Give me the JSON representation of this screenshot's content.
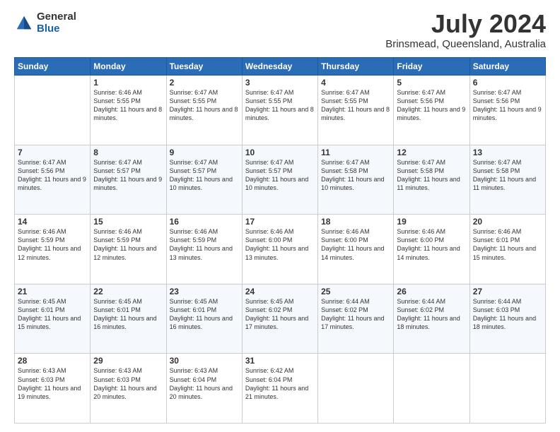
{
  "logo": {
    "general": "General",
    "blue": "Blue"
  },
  "title": {
    "month": "July 2024",
    "location": "Brinsmead, Queensland, Australia"
  },
  "headers": [
    "Sunday",
    "Monday",
    "Tuesday",
    "Wednesday",
    "Thursday",
    "Friday",
    "Saturday"
  ],
  "weeks": [
    [
      {
        "day": "",
        "sunrise": "",
        "sunset": "",
        "daylight": ""
      },
      {
        "day": "1",
        "sunrise": "Sunrise: 6:46 AM",
        "sunset": "Sunset: 5:55 PM",
        "daylight": "Daylight: 11 hours and 8 minutes."
      },
      {
        "day": "2",
        "sunrise": "Sunrise: 6:47 AM",
        "sunset": "Sunset: 5:55 PM",
        "daylight": "Daylight: 11 hours and 8 minutes."
      },
      {
        "day": "3",
        "sunrise": "Sunrise: 6:47 AM",
        "sunset": "Sunset: 5:55 PM",
        "daylight": "Daylight: 11 hours and 8 minutes."
      },
      {
        "day": "4",
        "sunrise": "Sunrise: 6:47 AM",
        "sunset": "Sunset: 5:55 PM",
        "daylight": "Daylight: 11 hours and 8 minutes."
      },
      {
        "day": "5",
        "sunrise": "Sunrise: 6:47 AM",
        "sunset": "Sunset: 5:56 PM",
        "daylight": "Daylight: 11 hours and 9 minutes."
      },
      {
        "day": "6",
        "sunrise": "Sunrise: 6:47 AM",
        "sunset": "Sunset: 5:56 PM",
        "daylight": "Daylight: 11 hours and 9 minutes."
      }
    ],
    [
      {
        "day": "7",
        "sunrise": "Sunrise: 6:47 AM",
        "sunset": "Sunset: 5:56 PM",
        "daylight": "Daylight: 11 hours and 9 minutes."
      },
      {
        "day": "8",
        "sunrise": "Sunrise: 6:47 AM",
        "sunset": "Sunset: 5:57 PM",
        "daylight": "Daylight: 11 hours and 9 minutes."
      },
      {
        "day": "9",
        "sunrise": "Sunrise: 6:47 AM",
        "sunset": "Sunset: 5:57 PM",
        "daylight": "Daylight: 11 hours and 10 minutes."
      },
      {
        "day": "10",
        "sunrise": "Sunrise: 6:47 AM",
        "sunset": "Sunset: 5:57 PM",
        "daylight": "Daylight: 11 hours and 10 minutes."
      },
      {
        "day": "11",
        "sunrise": "Sunrise: 6:47 AM",
        "sunset": "Sunset: 5:58 PM",
        "daylight": "Daylight: 11 hours and 10 minutes."
      },
      {
        "day": "12",
        "sunrise": "Sunrise: 6:47 AM",
        "sunset": "Sunset: 5:58 PM",
        "daylight": "Daylight: 11 hours and 11 minutes."
      },
      {
        "day": "13",
        "sunrise": "Sunrise: 6:47 AM",
        "sunset": "Sunset: 5:58 PM",
        "daylight": "Daylight: 11 hours and 11 minutes."
      }
    ],
    [
      {
        "day": "14",
        "sunrise": "Sunrise: 6:46 AM",
        "sunset": "Sunset: 5:59 PM",
        "daylight": "Daylight: 11 hours and 12 minutes."
      },
      {
        "day": "15",
        "sunrise": "Sunrise: 6:46 AM",
        "sunset": "Sunset: 5:59 PM",
        "daylight": "Daylight: 11 hours and 12 minutes."
      },
      {
        "day": "16",
        "sunrise": "Sunrise: 6:46 AM",
        "sunset": "Sunset: 5:59 PM",
        "daylight": "Daylight: 11 hours and 13 minutes."
      },
      {
        "day": "17",
        "sunrise": "Sunrise: 6:46 AM",
        "sunset": "Sunset: 6:00 PM",
        "daylight": "Daylight: 11 hours and 13 minutes."
      },
      {
        "day": "18",
        "sunrise": "Sunrise: 6:46 AM",
        "sunset": "Sunset: 6:00 PM",
        "daylight": "Daylight: 11 hours and 14 minutes."
      },
      {
        "day": "19",
        "sunrise": "Sunrise: 6:46 AM",
        "sunset": "Sunset: 6:00 PM",
        "daylight": "Daylight: 11 hours and 14 minutes."
      },
      {
        "day": "20",
        "sunrise": "Sunrise: 6:46 AM",
        "sunset": "Sunset: 6:01 PM",
        "daylight": "Daylight: 11 hours and 15 minutes."
      }
    ],
    [
      {
        "day": "21",
        "sunrise": "Sunrise: 6:45 AM",
        "sunset": "Sunset: 6:01 PM",
        "daylight": "Daylight: 11 hours and 15 minutes."
      },
      {
        "day": "22",
        "sunrise": "Sunrise: 6:45 AM",
        "sunset": "Sunset: 6:01 PM",
        "daylight": "Daylight: 11 hours and 16 minutes."
      },
      {
        "day": "23",
        "sunrise": "Sunrise: 6:45 AM",
        "sunset": "Sunset: 6:01 PM",
        "daylight": "Daylight: 11 hours and 16 minutes."
      },
      {
        "day": "24",
        "sunrise": "Sunrise: 6:45 AM",
        "sunset": "Sunset: 6:02 PM",
        "daylight": "Daylight: 11 hours and 17 minutes."
      },
      {
        "day": "25",
        "sunrise": "Sunrise: 6:44 AM",
        "sunset": "Sunset: 6:02 PM",
        "daylight": "Daylight: 11 hours and 17 minutes."
      },
      {
        "day": "26",
        "sunrise": "Sunrise: 6:44 AM",
        "sunset": "Sunset: 6:02 PM",
        "daylight": "Daylight: 11 hours and 18 minutes."
      },
      {
        "day": "27",
        "sunrise": "Sunrise: 6:44 AM",
        "sunset": "Sunset: 6:03 PM",
        "daylight": "Daylight: 11 hours and 18 minutes."
      }
    ],
    [
      {
        "day": "28",
        "sunrise": "Sunrise: 6:43 AM",
        "sunset": "Sunset: 6:03 PM",
        "daylight": "Daylight: 11 hours and 19 minutes."
      },
      {
        "day": "29",
        "sunrise": "Sunrise: 6:43 AM",
        "sunset": "Sunset: 6:03 PM",
        "daylight": "Daylight: 11 hours and 20 minutes."
      },
      {
        "day": "30",
        "sunrise": "Sunrise: 6:43 AM",
        "sunset": "Sunset: 6:04 PM",
        "daylight": "Daylight: 11 hours and 20 minutes."
      },
      {
        "day": "31",
        "sunrise": "Sunrise: 6:42 AM",
        "sunset": "Sunset: 6:04 PM",
        "daylight": "Daylight: 11 hours and 21 minutes."
      },
      {
        "day": "",
        "sunrise": "",
        "sunset": "",
        "daylight": ""
      },
      {
        "day": "",
        "sunrise": "",
        "sunset": "",
        "daylight": ""
      },
      {
        "day": "",
        "sunrise": "",
        "sunset": "",
        "daylight": ""
      }
    ]
  ]
}
